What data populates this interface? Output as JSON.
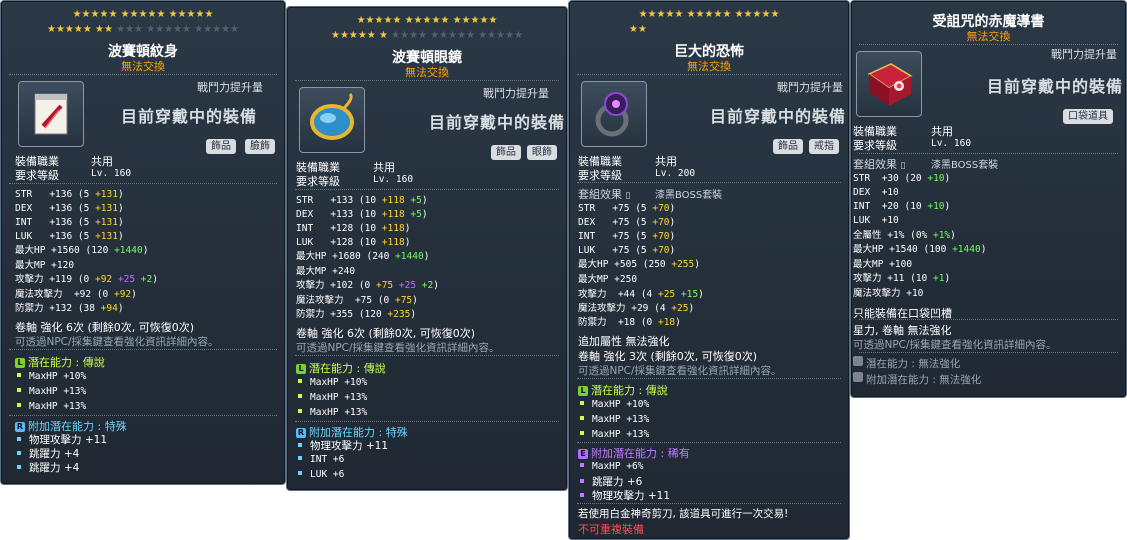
{
  "tooltips": [
    {
      "stars_row1": "★★★★★ ★★★★★ ★★★★★",
      "stars_row2_on": "★★★★★ ★★",
      "stars_row2_off": "★★★ ★★★★★ ★★★★★",
      "title": "波賽頓紋身",
      "untradeable": "無法交換",
      "combat_power": "戰鬥力提升量",
      "equipped": "目前穿戴中的裝備",
      "tags": [
        "飾品",
        "臉飾"
      ],
      "job_label": "裝備職業",
      "job_value": "共用",
      "level_label": "要求等級",
      "level_value": "Lv. 160",
      "stats": [
        {
          "name": "STR",
          "base": "+136",
          "detail": "(5 ",
          "bonus": "+131",
          ")": ")"
        },
        {
          "name": "DEX",
          "base": "+136",
          "detail": "(5 ",
          "bonus": "+131",
          ")": ")"
        },
        {
          "name": "INT",
          "base": "+136",
          "detail": "(5 ",
          "bonus": "+131",
          ")": ")"
        },
        {
          "name": "LUK",
          "base": "+136",
          "detail": "(5 ",
          "bonus": "+131",
          ")": ")"
        }
      ],
      "stat_lines": [
        "最大HP +1560 (120 ||+1440||)",
        "最大MP +120",
        "攻擊力 +119 (0 ##+92## ^^+25^^ ||+2||)",
        "魔法攻擊力 +92 (0 ##+92##)",
        "防禦力 +132 (38 ##+94##)"
      ],
      "scroll": "卷軸 強化 6次 (剩餘0次, 可恢復0次)",
      "npc_hint": "可透過NPC/採集鍵查看強化資訊詳細內容。",
      "potential_header": "潛在能力 : 傳說",
      "potential_badge": "L",
      "potential": [
        "MaxHP +10%",
        "MaxHP +13%",
        "MaxHP +13%"
      ],
      "add_potential_header": "附加潛在能力 : 特殊",
      "add_potential_badge": "R",
      "add_potential": [
        "物理攻擊力 +11",
        "跳躍力 +4",
        "跳躍力 +4"
      ]
    },
    {
      "stars_row1": "★★★★★ ★★★★★ ★★★★★",
      "stars_row2_on": "★★★★★ ★",
      "stars_row2_off": "★★★★ ★★★★★ ★★★★★",
      "title": "波賽頓眼鏡",
      "untradeable": "無法交換",
      "combat_power": "戰鬥力提升量",
      "equipped": "目前穿戴中的裝備",
      "tags": [
        "飾品",
        "眼飾"
      ],
      "job_label": "裝備職業",
      "job_value": "共用",
      "level_label": "要求等級",
      "level_value": "Lv. 160",
      "stat_lines": [
        "STR +133 (10 ##+118## ||+5||)",
        "DEX +133 (10 ##+118## ||+5||)",
        "INT +128 (10 ##+118##)",
        "LUK +128 (10 ##+118##)",
        "最大HP +1680 (240 ||+1440||)",
        "最大MP +240",
        "攻擊力 +102 (0 ##+75## ^^+25^^ ||+2||)",
        "魔法攻擊力 +75 (0 ##+75##)",
        "防禦力 +355 (120 ##+235##)"
      ],
      "scroll": "卷軸 強化 6次 (剩餘0次, 可恢復0次)",
      "npc_hint": "可透過NPC/採集鍵查看強化資訊詳細內容。",
      "potential_header": "潛在能力 : 傳說",
      "potential_badge": "L",
      "potential": [
        "MaxHP +10%",
        "MaxHP +13%",
        "MaxHP +13%"
      ],
      "add_potential_header": "附加潛在能力 : 特殊",
      "add_potential_badge": "R",
      "add_potential": [
        "物理攻擊力 +11",
        "INT +6",
        "LUK +6"
      ]
    },
    {
      "stars_row1": "★★★★★ ★★★★★ ★★★★★",
      "stars_row2_on": "★★",
      "stars_row2_off": "",
      "title": "巨大的恐怖",
      "untradeable": "無法交換",
      "combat_power": "戰鬥力提升量",
      "equipped": "目前穿戴中的裝備",
      "tags": [
        "飾品",
        "戒指"
      ],
      "job_label": "裝備職業",
      "job_value": "共用",
      "level_label": "要求等級",
      "level_value": "Lv. 200",
      "set_label": "套組效果",
      "set_value": "漆黑BOSS套裝",
      "stat_lines": [
        "STR +75 (5 ##+70##)",
        "DEX +75 (5 ##+70##)",
        "INT +75 (5 ##+70##)",
        "LUK +75 (5 ##+70##)",
        "最大HP +505 (250 ##+255##)",
        "最大MP +250",
        "攻擊力 +44 (4 ##+25## ||+15||)",
        "魔法攻擊力 +29 (4 ##+25##)",
        "防禦力 +18 (0 ##+18##)"
      ],
      "extra": "追加屬性 無法強化",
      "scroll": "卷軸 強化 3次 (剩餘0次, 可恢復0次)",
      "npc_hint": "可透過NPC/採集鍵查看強化資訊詳細內容。",
      "potential_header": "潛在能力 : 傳說",
      "potential_badge": "L",
      "potential": [
        "MaxHP +10%",
        "MaxHP +13%",
        "MaxHP +13%"
      ],
      "add_potential_header": "附加潛在能力 : 稀有",
      "add_potential_badge": "E",
      "add_potential": [
        "MaxHP +6%",
        "跳躍力 +6",
        "物理攻擊力 +11"
      ],
      "scissors": "若使用白金神奇剪刀, 該道具可進行一次交易!",
      "no_duplicate": "不可重複裝備"
    },
    {
      "title": "受詛咒的赤魔導書",
      "untradeable": "無法交換",
      "combat_power": "戰鬥力提升量",
      "equipped": "目前穿戴中的裝備",
      "tags": [
        "口袋道具"
      ],
      "job_label": "裝備職業",
      "job_value": "共用",
      "level_label": "要求等級",
      "level_value": "Lv. 160",
      "set_label": "套組效果",
      "set_value": "漆黑BOSS套裝",
      "stat_lines": [
        "STR +30 (20 ||+10||)",
        "DEX +10",
        "INT +20 (10 ||+10||)",
        "LUK +10",
        "全屬性 +1% (0% ||+1%||)",
        "最大HP +1540 (100 ||+1440||)",
        "最大MP +100",
        "攻擊力 +11 (10 ||+1||)",
        "魔法攻擊力 +10"
      ],
      "pocket_only": "只能裝備在口袋凹槽",
      "star_scroll": "星力, 卷軸 無法強化",
      "npc_hint": "可透過NPC/採集鍵查看強化資訊詳細內容。",
      "potential_na": "潛在能力 : 無法強化",
      "add_potential_na": "附加潛在能力 : 無法強化"
    }
  ]
}
